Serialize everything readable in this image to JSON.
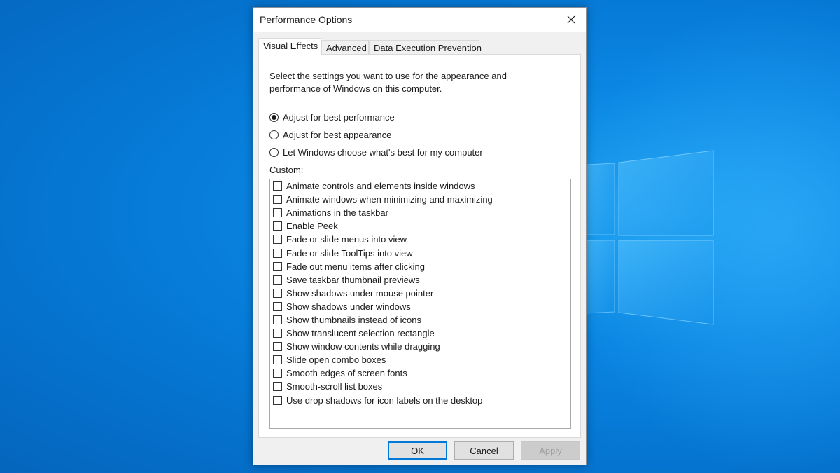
{
  "dialog": {
    "title": "Performance Options",
    "close_icon": "close-icon"
  },
  "tabs": [
    {
      "label": "Visual Effects",
      "active": true
    },
    {
      "label": "Advanced",
      "active": false
    },
    {
      "label": "Data Execution Prevention",
      "active": false
    }
  ],
  "panel": {
    "description_line1": "Select the settings you want to use for the appearance and",
    "description_line2": "performance of Windows on this computer.",
    "radios": [
      {
        "label": "Adjust for best performance",
        "checked": true
      },
      {
        "label": "Adjust for best appearance",
        "checked": false
      },
      {
        "label": "Let Windows choose what's best for my computer",
        "checked": false
      }
    ],
    "custom_label": "Custom:",
    "checkboxes": [
      {
        "label": "Animate controls and elements inside windows",
        "checked": false
      },
      {
        "label": "Animate windows when minimizing and maximizing",
        "checked": false
      },
      {
        "label": "Animations in the taskbar",
        "checked": false
      },
      {
        "label": "Enable Peek",
        "checked": false
      },
      {
        "label": "Fade or slide menus into view",
        "checked": false
      },
      {
        "label": "Fade or slide ToolTips into view",
        "checked": false
      },
      {
        "label": "Fade out menu items after clicking",
        "checked": false
      },
      {
        "label": "Save taskbar thumbnail previews",
        "checked": false
      },
      {
        "label": "Show shadows under mouse pointer",
        "checked": false
      },
      {
        "label": "Show shadows under windows",
        "checked": false
      },
      {
        "label": "Show thumbnails instead of icons",
        "checked": false
      },
      {
        "label": "Show translucent selection rectangle",
        "checked": false
      },
      {
        "label": "Show window contents while dragging",
        "checked": false
      },
      {
        "label": "Slide open combo boxes",
        "checked": false
      },
      {
        "label": "Smooth edges of screen fonts",
        "checked": false
      },
      {
        "label": "Smooth-scroll list boxes",
        "checked": false
      },
      {
        "label": "Use drop shadows for icon labels on the desktop",
        "checked": false
      }
    ]
  },
  "buttons": {
    "ok": "OK",
    "cancel": "Cancel",
    "apply": "Apply"
  },
  "colors": {
    "desktop": "#0a86e2",
    "accent": "#0078d7"
  }
}
